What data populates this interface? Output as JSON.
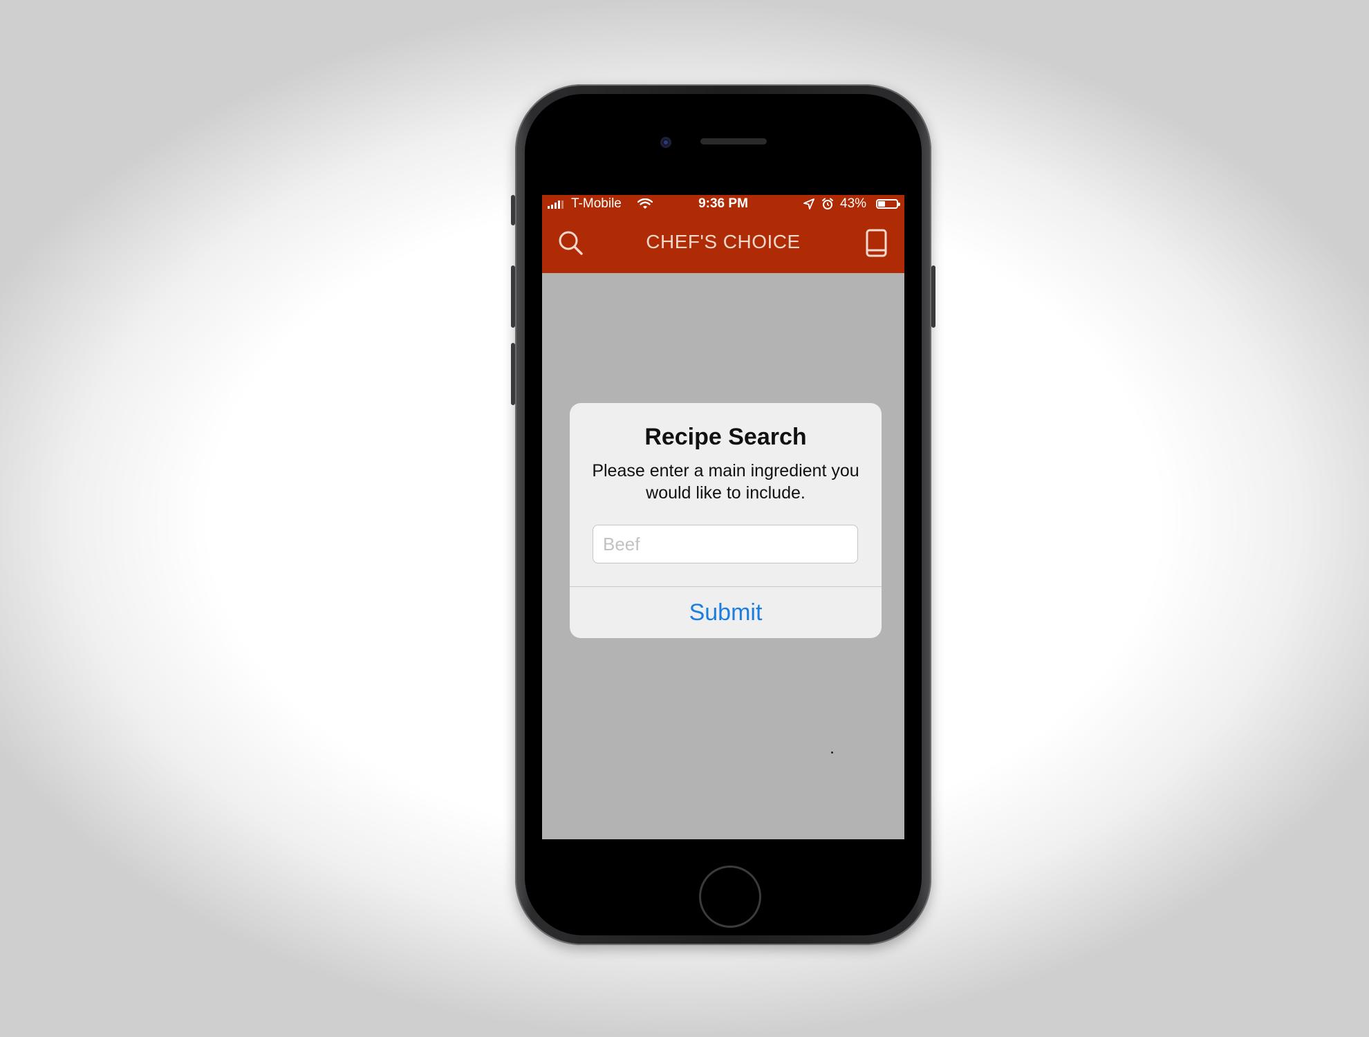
{
  "status_bar": {
    "carrier": "T-Mobile",
    "time": "9:36 PM",
    "battery_percent": "43%",
    "battery_level": 0.43,
    "icons": [
      "signal-icon",
      "wifi-icon",
      "location-arrow-icon",
      "alarm-icon",
      "battery-icon"
    ]
  },
  "nav": {
    "title": "CHEF'S CHOICE",
    "left_icon": "search-icon",
    "right_icon": "book-icon"
  },
  "alert": {
    "title": "Recipe Search",
    "message": "Please enter a main ingredient you would like to include.",
    "input_placeholder": "Beef",
    "input_value": "",
    "button_label": "Submit"
  },
  "colors": {
    "brand": "#ae2b06",
    "nav_title": "#f3d8cd",
    "overlay": "#b3b3b3",
    "alert_background": "#efefef",
    "button_text": "#1a7ee0"
  }
}
